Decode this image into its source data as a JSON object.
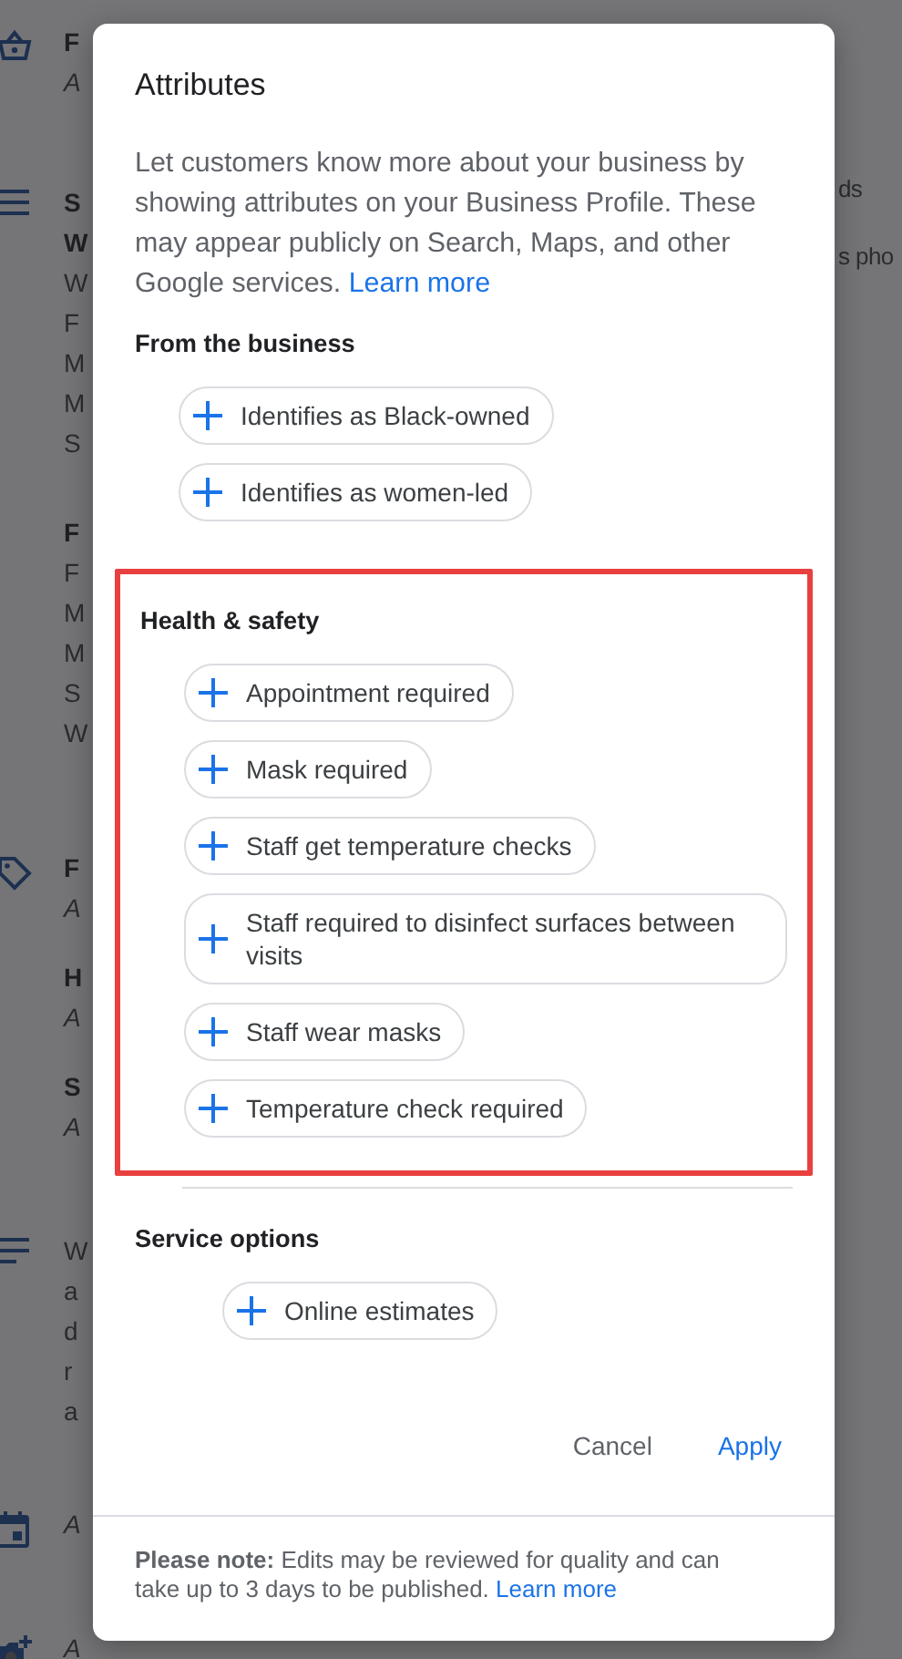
{
  "background": {
    "groups": [
      {
        "lines": [
          {
            "text": "F",
            "bold": true
          },
          {
            "text": "A",
            "bold": false
          }
        ]
      },
      {
        "lines": [
          {
            "text": "S",
            "bold": true
          },
          {
            "text": "W",
            "bold": true
          },
          {
            "text": "W",
            "bold": false
          },
          {
            "text": "F",
            "bold": false
          },
          {
            "text": "M",
            "bold": false
          },
          {
            "text": "M",
            "bold": false
          },
          {
            "text": "S",
            "bold": false
          }
        ]
      },
      {
        "lines": [
          {
            "text": "F",
            "bold": true
          },
          {
            "text": "F",
            "bold": false
          },
          {
            "text": "M",
            "bold": false
          },
          {
            "text": "M",
            "bold": false
          },
          {
            "text": "S",
            "bold": false
          },
          {
            "text": "W",
            "bold": false
          }
        ]
      },
      {
        "lines": [
          {
            "text": "F",
            "bold": true
          },
          {
            "text": "A",
            "bold": false
          }
        ]
      },
      {
        "lines": [
          {
            "text": "H",
            "bold": true
          },
          {
            "text": "A",
            "bold": false
          }
        ]
      },
      {
        "lines": [
          {
            "text": "S",
            "bold": true
          },
          {
            "text": "A",
            "bold": false
          }
        ]
      },
      {
        "lines": [
          {
            "text": "W",
            "bold": false
          },
          {
            "text": "a",
            "bold": false
          },
          {
            "text": "d",
            "bold": false
          },
          {
            "text": "r",
            "bold": false
          },
          {
            "text": "a",
            "bold": false
          }
        ]
      },
      {
        "lines": [
          {
            "text": "A",
            "bold": false
          }
        ]
      },
      {
        "lines": [
          {
            "text": "A",
            "bold": false
          }
        ]
      }
    ],
    "right_texts": [
      "ds",
      "s pho"
    ]
  },
  "dialog": {
    "title": "Attributes",
    "description": "Let customers know more about your business by showing attributes on your Business Profile. These may appear publicly on Search, Maps, and other Google services.",
    "description_link": "Learn more",
    "sections": [
      {
        "title": "From the business",
        "highlighted": false,
        "attributes": [
          "Identifies as Black-owned",
          "Identifies as women-led"
        ]
      },
      {
        "title": "Health & safety",
        "highlighted": true,
        "attributes": [
          "Appointment required",
          "Mask required",
          "Staff get temperature checks",
          "Staff required to disinfect surfaces between visits",
          "Staff wear masks",
          "Temperature check required"
        ]
      },
      {
        "title": "Service options",
        "highlighted": false,
        "attributes": [
          "Online estimates"
        ]
      }
    ],
    "buttons": [
      {
        "label": "Cancel",
        "kind": "secondary"
      },
      {
        "label": "Apply",
        "kind": "primary"
      }
    ],
    "note": {
      "label": "Please note:",
      "text": "Edits may be reviewed for quality and can take up to 3 days to be published.",
      "link": "Learn more"
    }
  }
}
